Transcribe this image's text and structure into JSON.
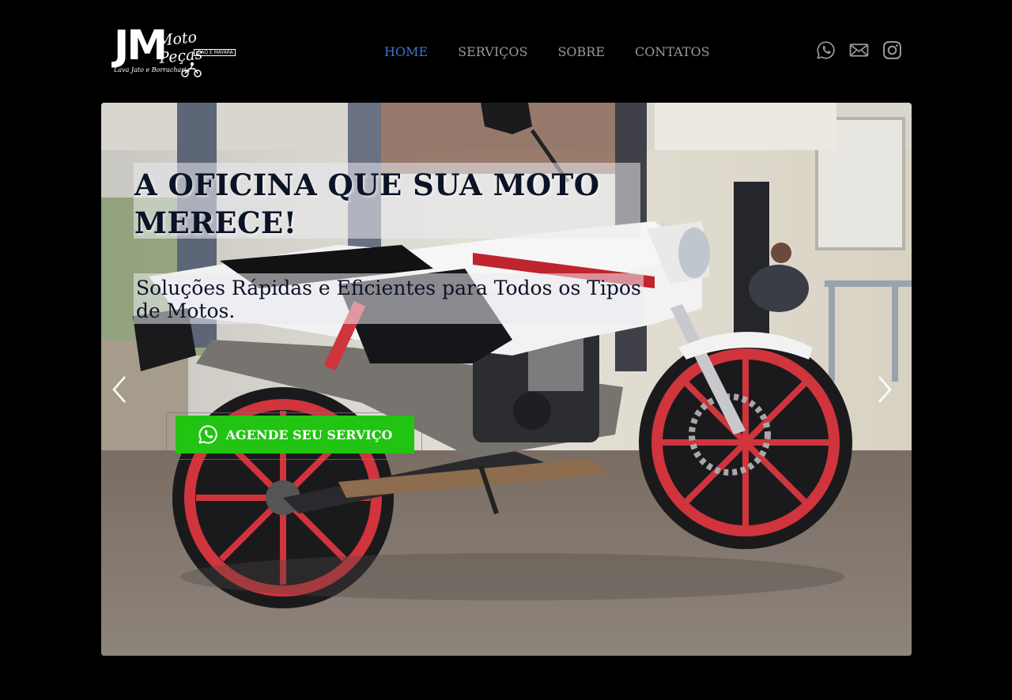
{
  "brand": {
    "initials": "JM",
    "script": "Moto Peças",
    "tag": "JOÃO E MAYARA",
    "subtitle": "Lava Jato e Borracharia"
  },
  "nav": [
    {
      "label": "HOME",
      "active": true
    },
    {
      "label": "SERVIÇOS",
      "active": false
    },
    {
      "label": "SOBRE",
      "active": false
    },
    {
      "label": "CONTATOS",
      "active": false
    }
  ],
  "social": [
    "whatsapp-icon",
    "mail-icon",
    "instagram-icon"
  ],
  "hero": {
    "headline_line1": "A OFICINA QUE SUA MOTO",
    "headline_line2": "MERECE!",
    "subline_line1": "Soluções Rápidas e Eficientes para Todos os Tipos",
    "subline_line2": "de Motos.",
    "cta_label": "AGENDE SEU SERVIÇO",
    "cta_color": "#21c412"
  },
  "colors": {
    "background": "#000000",
    "nav_active": "#3a74d0",
    "nav_inactive": "#9a9a9a",
    "headline": "#0b1326"
  }
}
